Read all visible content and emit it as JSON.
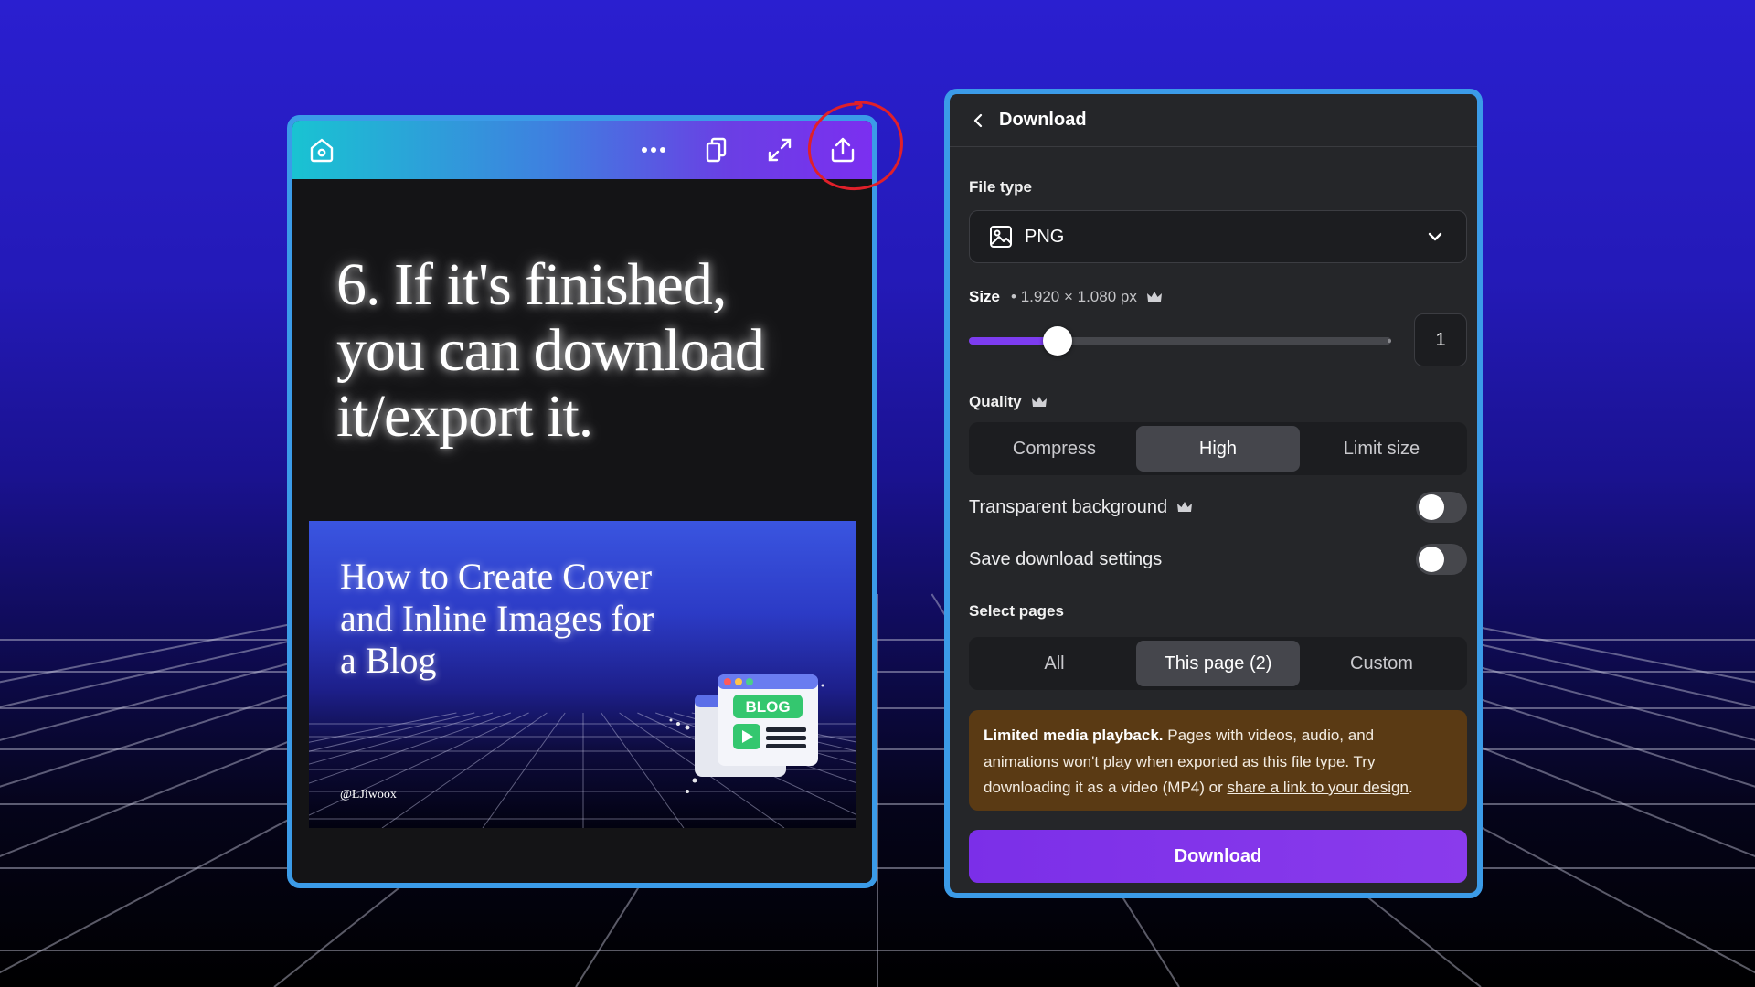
{
  "phone": {
    "toolbar": {
      "home_icon": "home-icon",
      "more_icon": "more-dots-icon",
      "duplicate_icon": "duplicate-icon",
      "fullscreen_icon": "fullscreen-icon",
      "share_icon": "share-upload-icon"
    },
    "slide_title_lines": [
      "6. If it's finished,",
      "you can download",
      "it/export it."
    ],
    "inner_image": {
      "title_lines": [
        "How to Create Cover",
        "and Inline Images for",
        "a Blog"
      ],
      "badge": "BLOG",
      "handle": "@LJiwoox"
    }
  },
  "panel": {
    "title": "Download",
    "file_type": {
      "label": "File type",
      "value": "PNG"
    },
    "size": {
      "label": "Size",
      "dimensions": "• 1.920 × 1.080 px",
      "value": "1",
      "slider_fraction": 0.21
    },
    "quality": {
      "label": "Quality",
      "options": [
        "Compress",
        "High",
        "Limit size"
      ],
      "selected": "High"
    },
    "transparent_background": {
      "label": "Transparent background",
      "on": false
    },
    "save_settings": {
      "label": "Save download settings",
      "on": false
    },
    "select_pages": {
      "label": "Select pages",
      "options": [
        "All",
        "This page (2)",
        "Custom"
      ],
      "selected": "This page (2)"
    },
    "notice": {
      "bold": "Limited media playback.",
      "text": " Pages with videos, audio, and animations won't play when exported as this file type. Try downloading it as a video (MP4) or ",
      "link": "share a link to your design",
      "end": "."
    },
    "download_button": "Download",
    "accent": "#7b2fe8",
    "notice_color": "#5a3a14"
  }
}
